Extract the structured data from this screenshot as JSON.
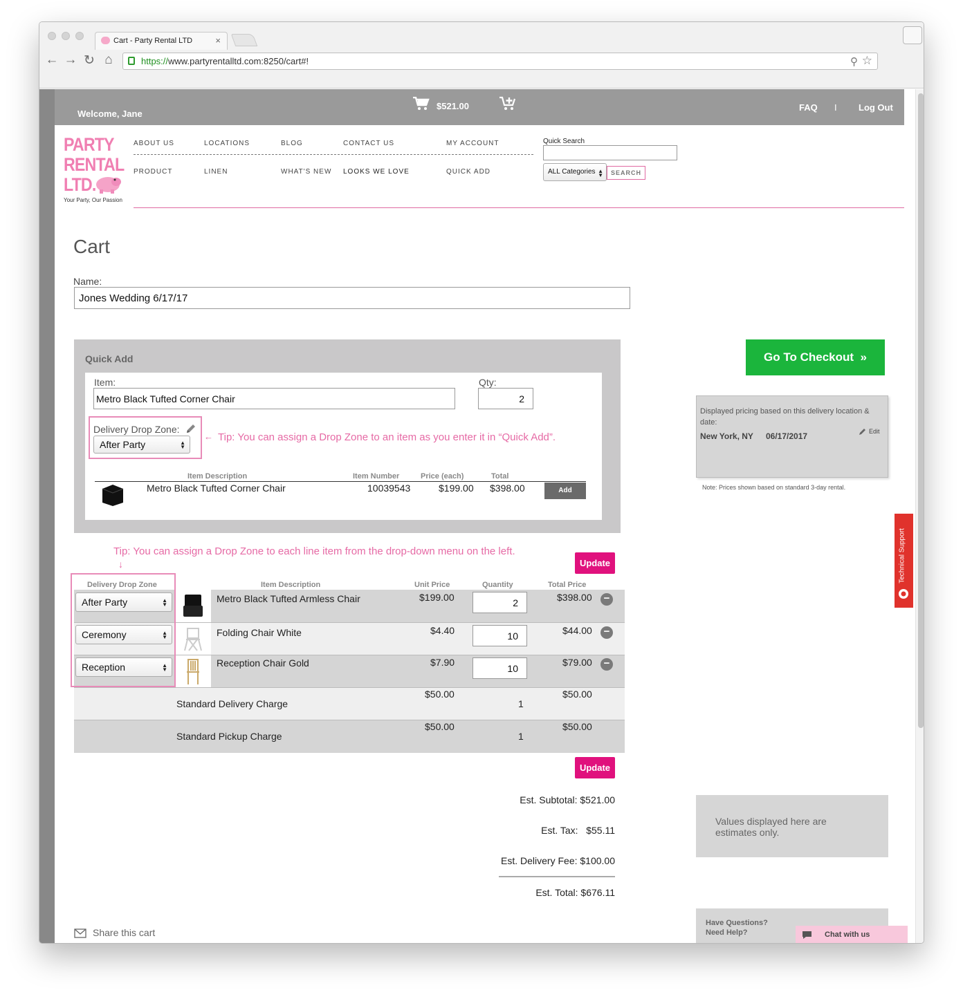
{
  "browser": {
    "tab_title": "Cart - Party Rental LTD",
    "tab_close": "×",
    "url_scheme": "https://",
    "url_rest": "www.partyrentalltd.com:8250/cart#!",
    "nav_back": "←",
    "nav_forward": "→",
    "nav_reload": "↻",
    "nav_home": "⌂",
    "search_glyph": "⚲",
    "star_glyph": "☆"
  },
  "topbar": {
    "welcome": "Welcome, Jane",
    "cart_total": "$521.00",
    "faq": "FAQ",
    "separator": "I",
    "logout": "Log Out"
  },
  "logo": {
    "line1": "PARTY",
    "line2": "RENTAL",
    "line3": "LTD.",
    "tagline": "Your Party, Our Passion"
  },
  "nav": {
    "row1": [
      "ABOUT US",
      "LOCATIONS",
      "BLOG",
      "CONTACT US",
      "MY ACCOUNT"
    ],
    "row2": [
      "PRODUCT",
      "LINEN",
      "WHAT'S NEW",
      "LOOKS WE LOVE",
      "QUICK ADD"
    ]
  },
  "quick_search": {
    "label": "Quick Search",
    "category": "ALL Categories",
    "button": "SEARCH"
  },
  "cart": {
    "title": "Cart",
    "name_label": "Name:",
    "name_value": "Jones Wedding 6/17/17"
  },
  "quick_add": {
    "title": "Quick Add",
    "item_label": "Item:",
    "item_value": "Metro Black Tufted Corner Chair",
    "qty_label": "Qty:",
    "qty_value": "2",
    "drop_zone_label": "Delivery Drop Zone:",
    "drop_zone_value": "After Party",
    "tip": "Tip: You can assign a Drop Zone to an item as you enter it in “Quick Add”.",
    "tip_arrow": "←",
    "headers": [
      "Item Description",
      "Item Number",
      "Price (each)",
      "Total"
    ],
    "result": {
      "description": "Metro Black Tufted Corner Chair",
      "number": "10039543",
      "price": "$199.00",
      "total": "$398.00"
    },
    "add_button": "Add"
  },
  "line_items": {
    "tip": "Tip: You can assign a Drop Zone to each line item from the drop-down menu on the left.",
    "tip_arrow": "↓",
    "update_label": "Update",
    "headers": {
      "drop_zone": "Delivery Drop Zone",
      "description": "Item Description",
      "unit_price": "Unit Price",
      "quantity": "Quantity",
      "total_price": "Total Price"
    },
    "items": [
      {
        "zone": "After Party",
        "description": "Metro Black Tufted Armless Chair",
        "unit_price": "$199.00",
        "quantity": "2",
        "total": "$398.00"
      },
      {
        "zone": "Ceremony",
        "description": "Folding Chair White",
        "unit_price": "$4.40",
        "quantity": "10",
        "total": "$44.00"
      },
      {
        "zone": "Reception",
        "description": "Reception Chair Gold",
        "unit_price": "$7.90",
        "quantity": "10",
        "total": "$79.00"
      }
    ],
    "charges": [
      {
        "description": "Standard Delivery Charge",
        "unit_price": "$50.00",
        "quantity": "1",
        "total": "$50.00"
      },
      {
        "description": "Standard Pickup Charge",
        "unit_price": "$50.00",
        "quantity": "1",
        "total": "$50.00"
      }
    ],
    "remove_glyph": "−"
  },
  "totals": {
    "subtotal": "Est. Subtotal: $521.00",
    "tax_label": "Est. Tax:",
    "tax_value": "$55.11",
    "delivery": "Est. Delivery Fee: $100.00",
    "total": "Est. Total: $676.11"
  },
  "sidebar": {
    "checkout": "Go To Checkout",
    "checkout_arrow": "»",
    "pricing_note": "Displayed pricing based on this delivery location & date:",
    "location": "New York, NY",
    "date": "06/17/2017",
    "edit": "Edit",
    "rental_note": "Note: Prices shown based on standard 3-day rental.",
    "estimates": "Values displayed here are estimates only.",
    "questions_line1": "Have Questions?",
    "questions_line2": "Need Help?",
    "chat": "Chat with us",
    "tech_support": "Technical Support"
  },
  "share": "Share this cart",
  "colors": {
    "brand_pink": "#e0117d",
    "checkout_green": "#1bb53c",
    "topbar_gray": "#9a9a9a",
    "tip_pink": "#e66aa5",
    "support_red": "#e0322c"
  }
}
